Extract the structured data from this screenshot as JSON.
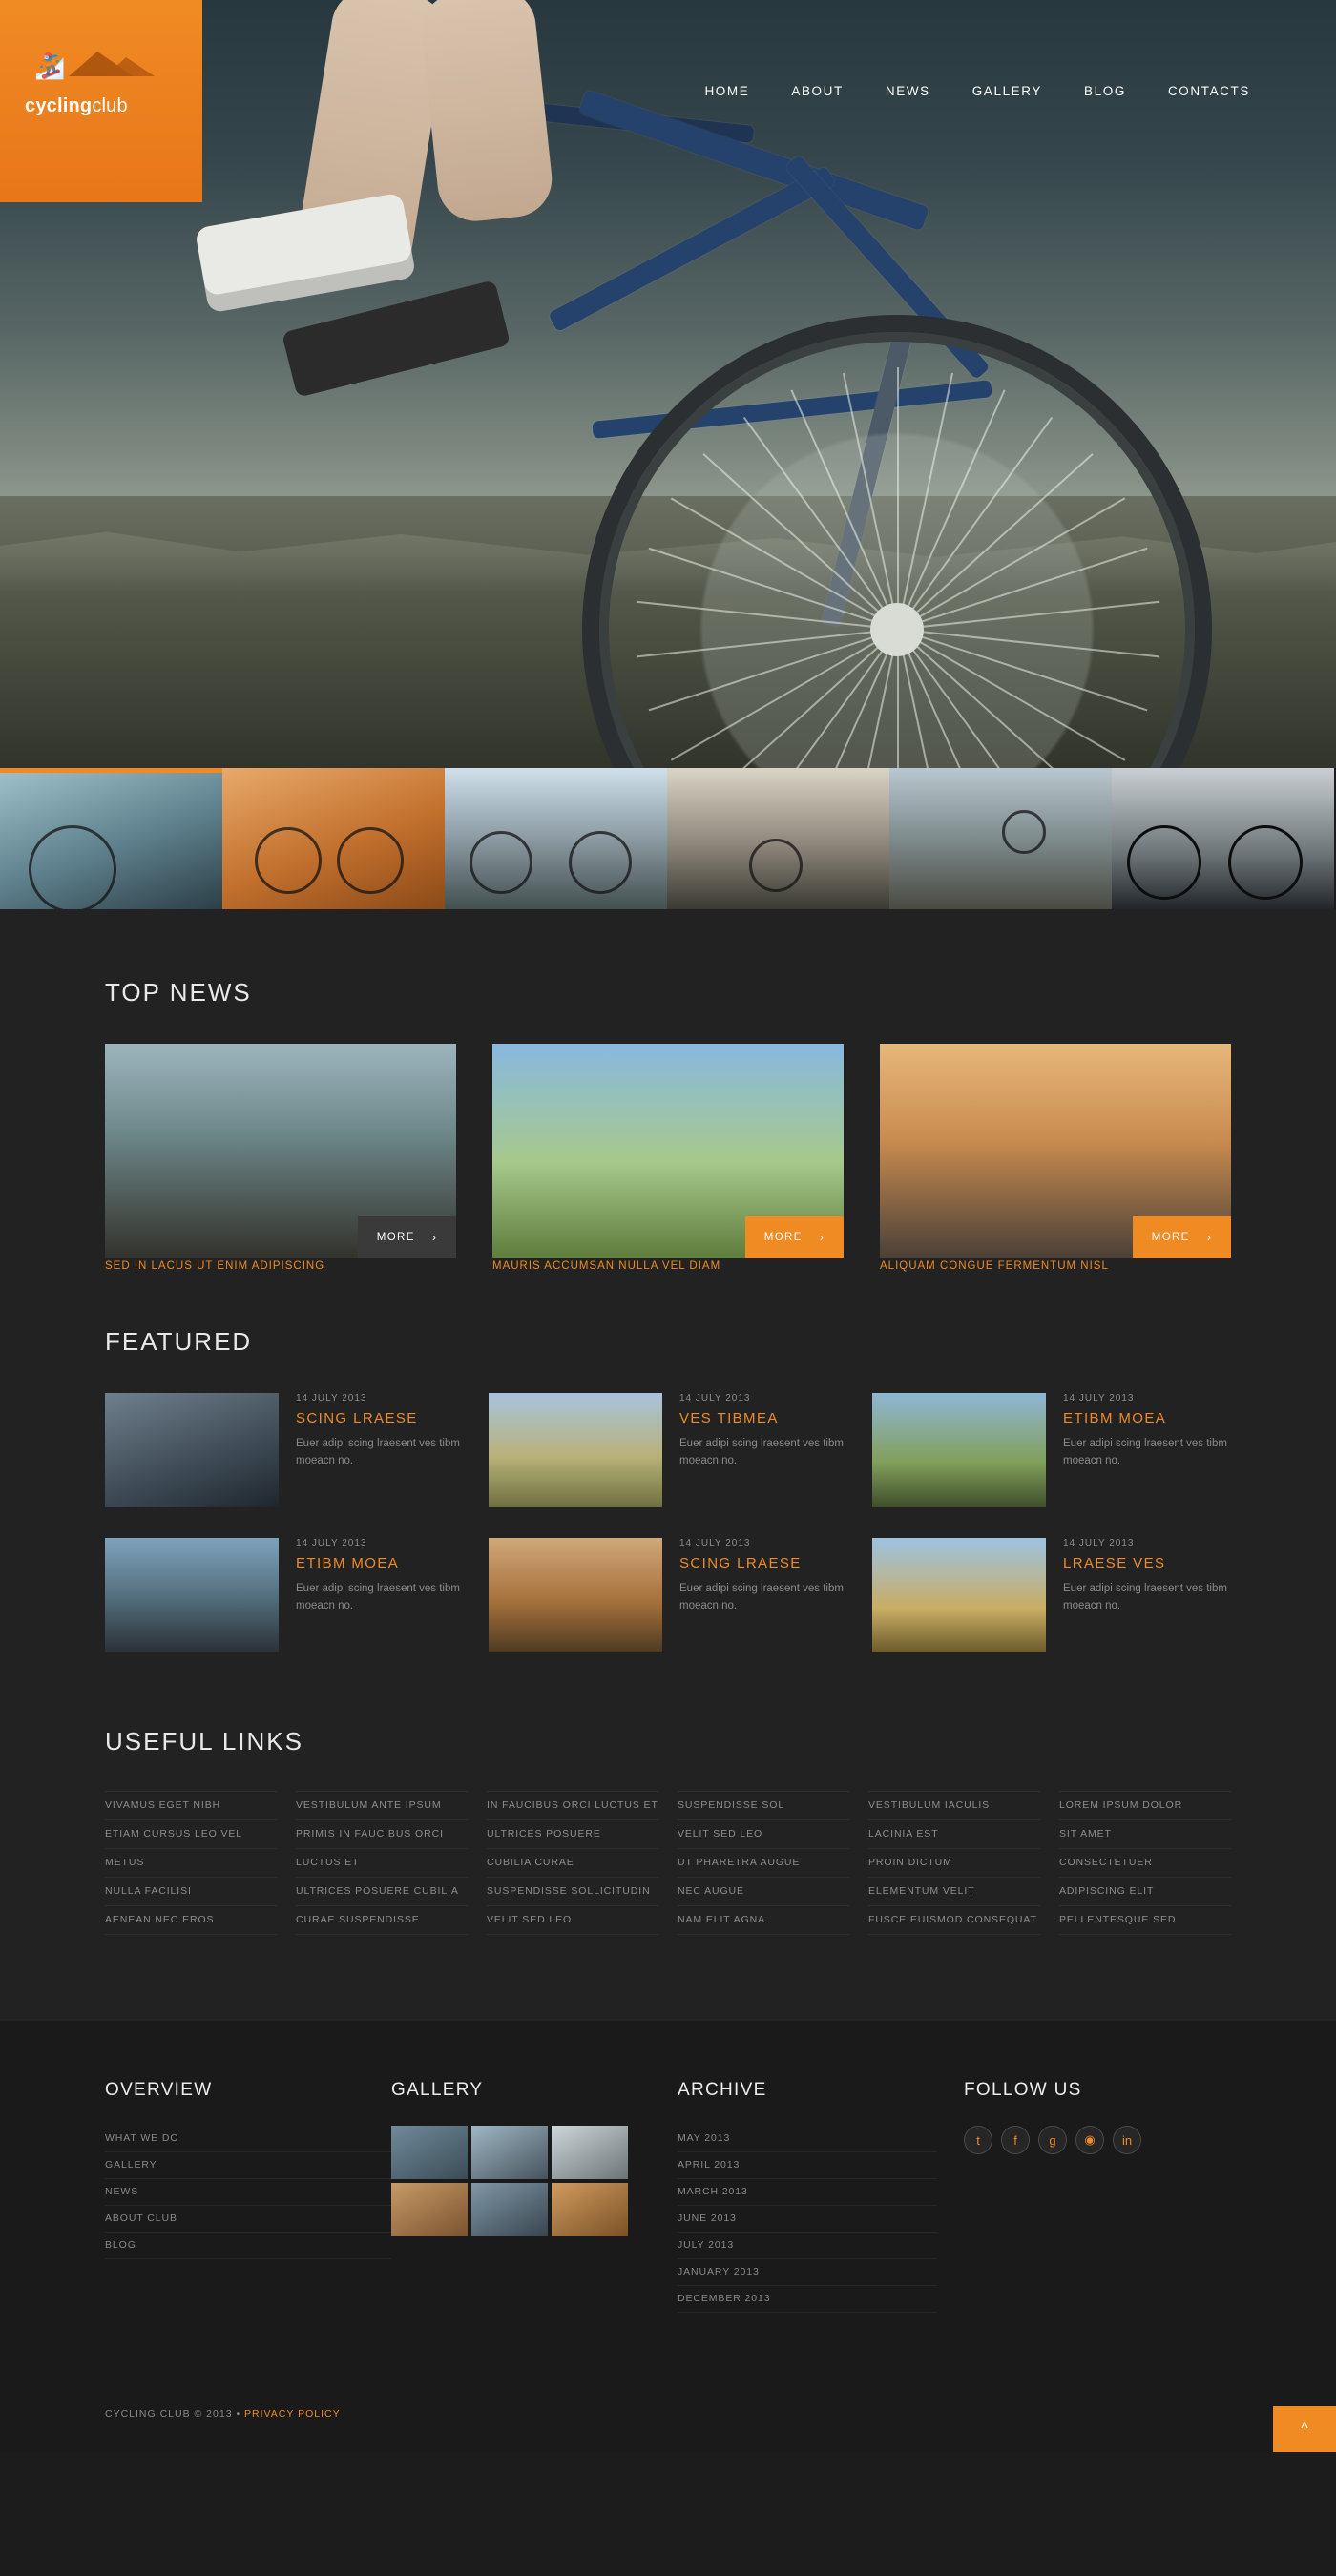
{
  "site": {
    "logo_primary": "cycling",
    "logo_secondary": "club",
    "logo_icon": "cyclist-mountain-icon"
  },
  "nav": {
    "items": [
      {
        "label": "HOME",
        "active": true
      },
      {
        "label": "ABOUT",
        "active": false
      },
      {
        "label": "NEWS",
        "active": false
      },
      {
        "label": "GALLERY",
        "active": false
      },
      {
        "label": "BLOG",
        "active": false
      },
      {
        "label": "CONTACTS",
        "active": false
      }
    ]
  },
  "slider_thumbs": [
    {
      "name": "thumb-1",
      "active": true
    },
    {
      "name": "thumb-2",
      "active": false
    },
    {
      "name": "thumb-3",
      "active": false
    },
    {
      "name": "thumb-4",
      "active": false
    },
    {
      "name": "thumb-5",
      "active": false
    },
    {
      "name": "thumb-6",
      "active": false
    }
  ],
  "top_news": {
    "title": "TOP NEWS",
    "more_label": "MORE",
    "chevron": "›",
    "cards": [
      {
        "caption": "SED IN LACUS UT ENIM ADIPISCING",
        "more_label": "MORE",
        "button_style": "grey"
      },
      {
        "caption": "MAURIS ACCUMSAN NULLA VEL DIAM",
        "more_label": "MORE",
        "button_style": "orange"
      },
      {
        "caption": "ALIQUAM CONGUE FERMENTUM NISL",
        "more_label": "MORE",
        "button_style": "orange"
      }
    ]
  },
  "featured": {
    "title": "FEATURED",
    "items": [
      {
        "date": "14 JULY 2013",
        "heading": "SCING LRAESE",
        "text": "Euer adipi scing lraesent ves tibm moeacn no."
      },
      {
        "date": "14 JULY 2013",
        "heading": "VES TIBMEA",
        "text": "Euer adipi scing lraesent ves tibm moeacn no."
      },
      {
        "date": "14 JULY 2013",
        "heading": "ETIBM MOEA",
        "text": "Euer adipi scing lraesent ves tibm moeacn no."
      },
      {
        "date": "14 JULY 2013",
        "heading": "ETIBM MOEA",
        "text": "Euer adipi scing lraesent ves tibm moeacn no."
      },
      {
        "date": "14 JULY 2013",
        "heading": "SCING LRAESE",
        "text": "Euer adipi scing lraesent ves tibm moeacn no."
      },
      {
        "date": "14 JULY 2013",
        "heading": "LRAESE VES",
        "text": "Euer adipi scing lraesent ves tibm moeacn no."
      }
    ]
  },
  "useful_links": {
    "title": "USEFUL LINKS",
    "columns": [
      [
        "VIVAMUS EGET NIBH",
        "ETIAM CURSUS LEO VEL",
        "METUS",
        "NULLA FACILISI",
        "AENEAN NEC EROS"
      ],
      [
        "VESTIBULUM ANTE IPSUM",
        "PRIMIS IN FAUCIBUS ORCI",
        "LUCTUS ET",
        "ULTRICES POSUERE CUBILIA",
        "CURAE SUSPENDISSE"
      ],
      [
        "IN FAUCIBUS ORCI LUCTUS ET",
        "ULTRICES POSUERE",
        "CUBILIA CURAE",
        "SUSPENDISSE SOLLICITUDIN",
        "VELIT SED LEO"
      ],
      [
        "SUSPENDISSE SOL",
        "VELIT SED LEO",
        "UT PHARETRA AUGUE",
        "NEC AUGUE",
        "NAM ELIT AGNA"
      ],
      [
        "VESTIBULUM IACULIS",
        "LACINIA EST",
        "PROIN DICTUM",
        "ELEMENTUM VELIT",
        "FUSCE EUISMOD CONSEQUAT"
      ],
      [
        "LOREM IPSUM DOLOR",
        "SIT AMET",
        "CONSECTETUER",
        "ADIPISCING ELIT",
        "PELLENTESQUE SED"
      ]
    ]
  },
  "footer": {
    "overview": {
      "title": "OVERVIEW",
      "items": [
        "WHAT WE DO",
        "GALLERY",
        "NEWS",
        "ABOUT CLUB",
        "BLOG"
      ]
    },
    "gallery": {
      "title": "GALLERY",
      "cells": [
        "gallery-thumb-1",
        "gallery-thumb-2",
        "gallery-thumb-3",
        "gallery-thumb-4",
        "gallery-thumb-5",
        "gallery-thumb-6"
      ]
    },
    "archive": {
      "title": "ARCHIVE",
      "items": [
        "MAY 2013",
        "APRIL 2013",
        "MARCH 2013",
        "JUNE 2013",
        "JULY 2013",
        "JANUARY 2013",
        "DECEMBER 2013"
      ]
    },
    "follow": {
      "title": "FOLLOW US",
      "socials": [
        {
          "name": "twitter-icon",
          "glyph": "t"
        },
        {
          "name": "facebook-icon",
          "glyph": "f"
        },
        {
          "name": "google-plus-icon",
          "glyph": "g"
        },
        {
          "name": "rss-icon",
          "glyph": "◉"
        },
        {
          "name": "linkedin-icon",
          "glyph": "in"
        }
      ]
    },
    "copyright": "CYCLING CLUB © 2013 • ",
    "privacy_label": "PRIVACY POLICY",
    "to_top_icon": "^"
  },
  "colors": {
    "accent": "#f08b23",
    "bg": "#222222",
    "footer_bg": "#1a1a1a",
    "text_muted": "#8a8a8a"
  }
}
